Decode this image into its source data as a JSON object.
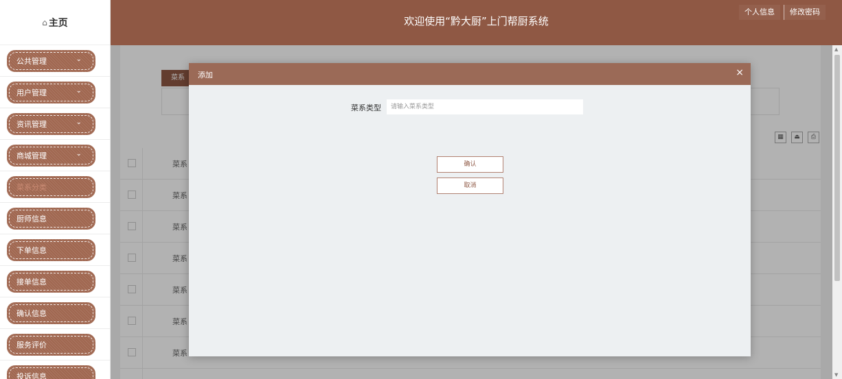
{
  "app": {
    "title": "欢迎使用“黔大厨”上门帮厨系统",
    "home_label": "主页",
    "home_icon": "⌂"
  },
  "header_buttons": {
    "profile": "个人信息",
    "change_password": "修改密码"
  },
  "sidebar": {
    "items": [
      {
        "label": "公共管理",
        "has_chevron": true
      },
      {
        "label": "用户管理",
        "has_chevron": true
      },
      {
        "label": "资讯管理",
        "has_chevron": true
      },
      {
        "label": "商城管理",
        "has_chevron": true
      },
      {
        "label": "菜系分类",
        "active": true
      },
      {
        "label": "厨师信息"
      },
      {
        "label": "下单信息"
      },
      {
        "label": "接单信息"
      },
      {
        "label": "确认信息"
      },
      {
        "label": "服务评价"
      },
      {
        "label": "投诉信息"
      }
    ],
    "chevron_glyph": "⌄"
  },
  "background": {
    "tab_label": "菜系",
    "column_header": "菜系",
    "row_cells": [
      "菜系",
      "菜系",
      "菜系",
      "菜系",
      "菜系",
      "菜系"
    ]
  },
  "modal": {
    "title": "添加",
    "close": "×",
    "field_label": "菜系类型",
    "field_placeholder": "请输入菜系类型",
    "field_value": "",
    "confirm": "确认",
    "cancel": "取消"
  },
  "colors": {
    "primary": "#8f5844",
    "modal_header": "#9b6a57",
    "sidebar_pill": "#a06750"
  }
}
